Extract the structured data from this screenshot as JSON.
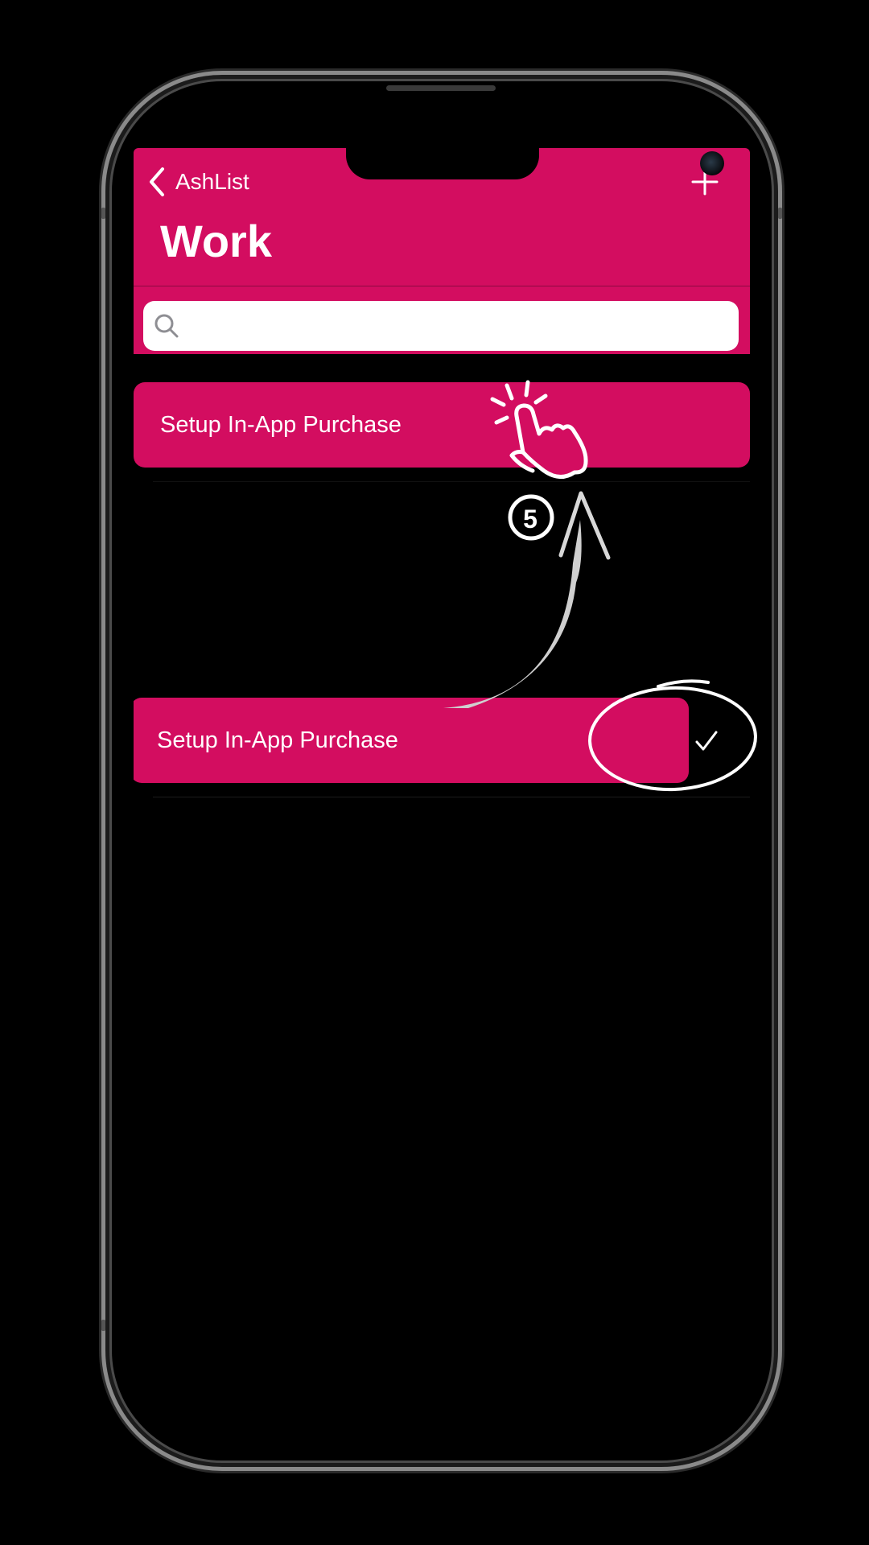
{
  "nav": {
    "back_label": "AshList",
    "title": "Work"
  },
  "search": {
    "placeholder": ""
  },
  "list": {
    "items": [
      {
        "label": "Setup In-App Purchase"
      }
    ]
  },
  "swiped_row": {
    "label": "Setup In-App Purchase",
    "action_icon": "checkmark-icon"
  },
  "annotation": {
    "step": "5",
    "icons": [
      "tap-hand-icon",
      "curved-arrow-icon",
      "circle-highlight"
    ]
  },
  "colors": {
    "accent": "#d30d60",
    "background": "#000000",
    "text": "#ffffff"
  }
}
